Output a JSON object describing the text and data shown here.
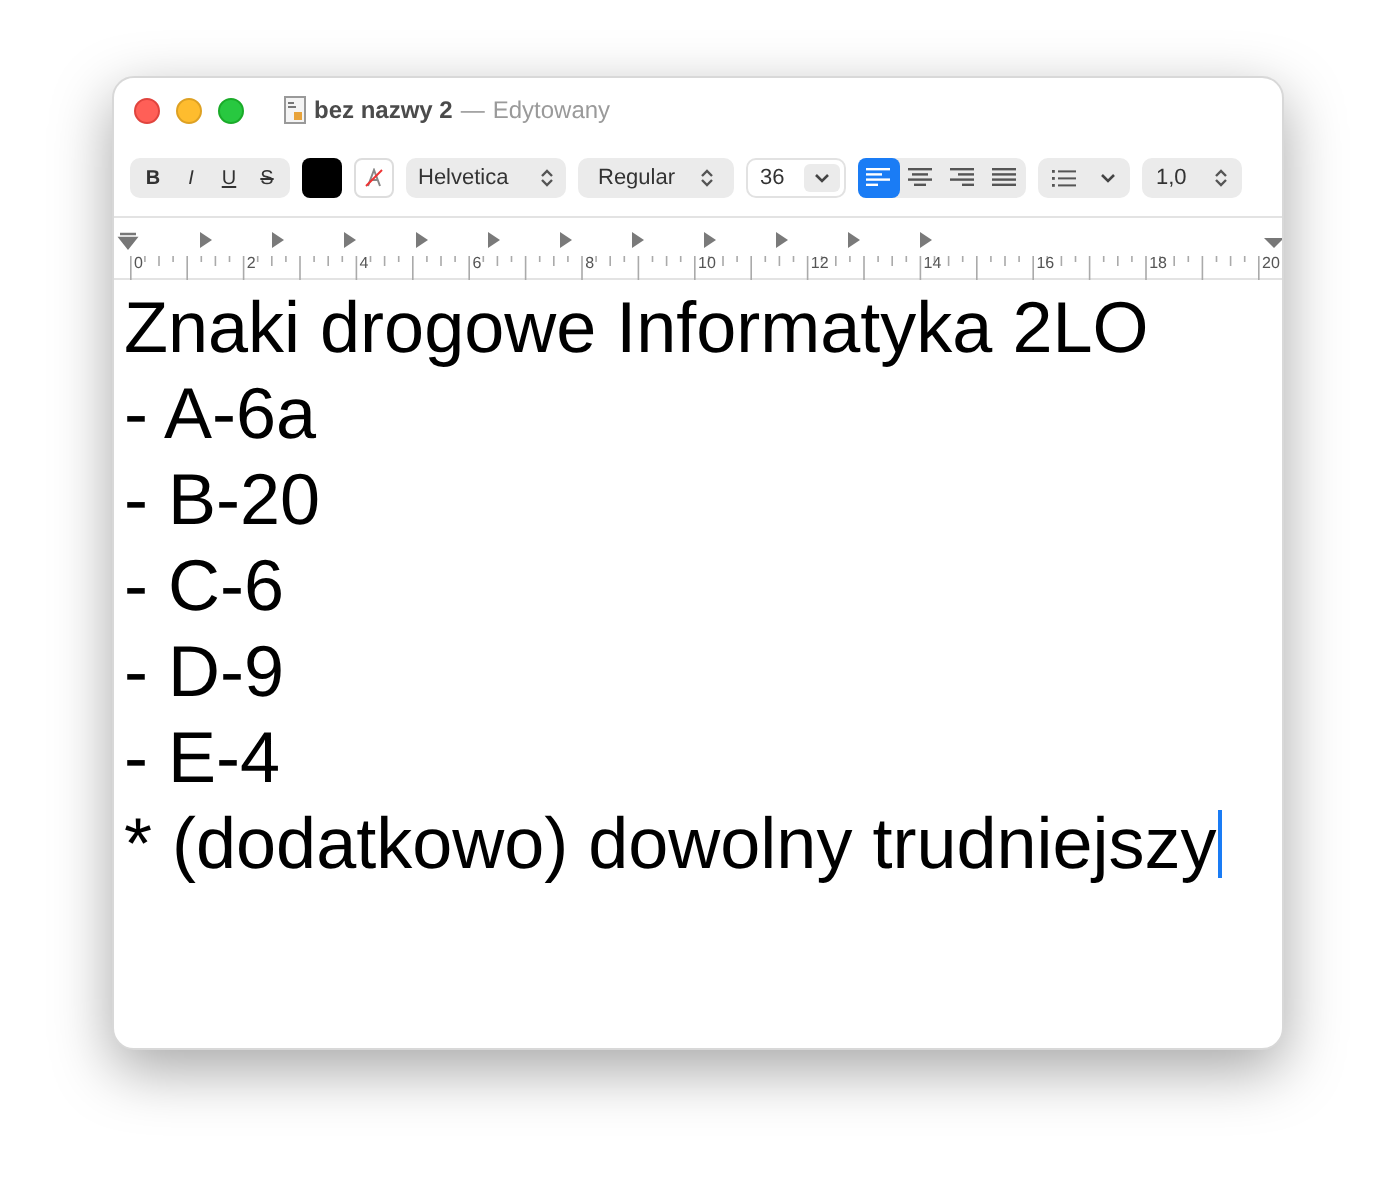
{
  "window": {
    "title": "bez nazwy 2",
    "separator": "—",
    "status": "Edytowany"
  },
  "toolbar": {
    "format_buttons": [
      {
        "label": "B",
        "kind": "bold"
      },
      {
        "label": "I",
        "kind": "italic"
      },
      {
        "label": "U",
        "kind": "underline"
      },
      {
        "label": "S",
        "kind": "strike"
      }
    ],
    "font": "Helvetica",
    "style": "Regular",
    "size": "36",
    "alignment": [
      {
        "kind": "left",
        "selected": true
      },
      {
        "kind": "center",
        "selected": false
      },
      {
        "kind": "right",
        "selected": false
      },
      {
        "kind": "justify",
        "selected": false
      }
    ],
    "line_spacing": "1,0"
  },
  "ruler": {
    "labels": [
      "0",
      "2",
      "4",
      "6",
      "8",
      "10",
      "12",
      "14",
      "16",
      "18",
      "20"
    ]
  },
  "document": {
    "lines": [
      "Znaki drogowe Informatyka 2LO",
      "- A-6a",
      "- B-20",
      "- C-6",
      "- D-9",
      "- E-4",
      "* (dodatkowo) dowolny trudniejszy"
    ]
  }
}
